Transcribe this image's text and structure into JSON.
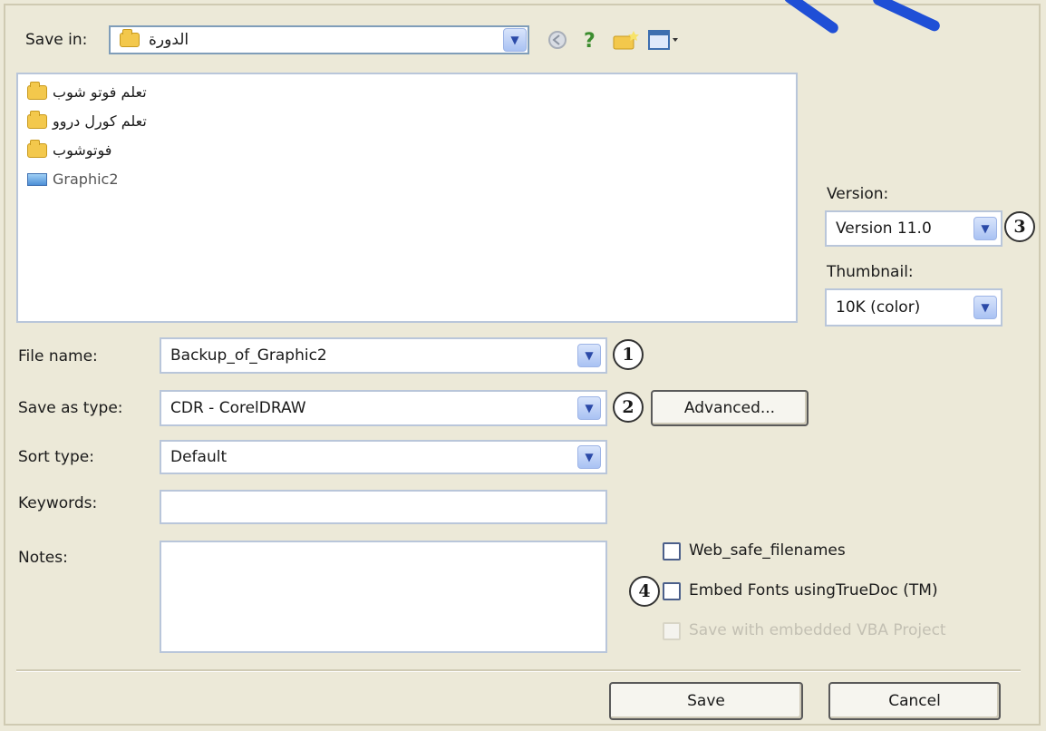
{
  "save_in": {
    "label": "Save in:",
    "value": "الدورة"
  },
  "toolbar": {
    "icons": [
      "back-icon",
      "help-icon",
      "new-folder-icon",
      "views-icon"
    ]
  },
  "file_list": [
    {
      "name": "تعلم فوتو شوب",
      "icon": "folder-icon"
    },
    {
      "name": "تعلم كورل دروو",
      "icon": "folder-icon"
    },
    {
      "name": "فوتوشوب",
      "icon": "folder-icon"
    },
    {
      "name": "Graphic2",
      "icon": "cdr-file-icon"
    }
  ],
  "version": {
    "label": "Version:",
    "value": "Version 11.0"
  },
  "thumbnail": {
    "label": "Thumbnail:",
    "value": "10K (color)"
  },
  "file_name": {
    "label": "File name:",
    "value": "Backup_of_Graphic2"
  },
  "save_as_type": {
    "label": "Save as type:",
    "value": "CDR - CorelDRAW"
  },
  "advanced_button": "Advanced...",
  "sort_type": {
    "label": "Sort type:",
    "value": "Default"
  },
  "keywords": {
    "label": "Keywords:",
    "value": ""
  },
  "notes": {
    "label": "Notes:",
    "value": ""
  },
  "options": {
    "web_safe": {
      "label": "Web_safe_filenames",
      "checked": false
    },
    "embed_fonts": {
      "label": "Embed Fonts usingTrueDoc (TM)",
      "checked": false
    },
    "vba_project": {
      "label": "Save with embedded VBA Project",
      "checked": false,
      "disabled": true
    }
  },
  "callouts": [
    "1",
    "2",
    "3",
    "4"
  ],
  "buttons": {
    "save": "Save",
    "cancel": "Cancel"
  },
  "colors": {
    "dialog_bg": "#ece9d8",
    "accent": "#1f4fd6"
  }
}
